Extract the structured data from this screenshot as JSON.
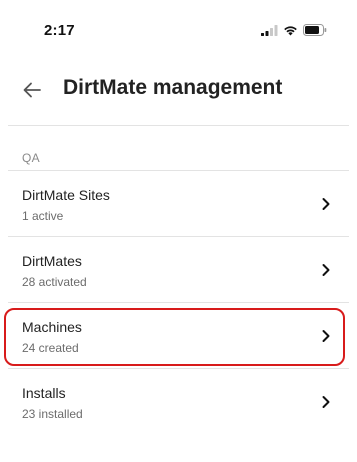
{
  "status_bar": {
    "time": "2:17",
    "icons": [
      "cellular-signal-icon",
      "wifi-icon",
      "battery-icon"
    ]
  },
  "header": {
    "back_icon": "arrow-left-icon",
    "title": "DirtMate management"
  },
  "section": {
    "label": "QA"
  },
  "items": [
    {
      "title": "DirtMate Sites",
      "subtitle": "1 active",
      "icon": "chevron-right-icon"
    },
    {
      "title": "DirtMates",
      "subtitle": "28 activated",
      "icon": "chevron-right-icon"
    },
    {
      "title": "Machines",
      "subtitle": "24 created",
      "icon": "chevron-right-icon",
      "highlighted": true
    },
    {
      "title": "Installs",
      "subtitle": "23 installed",
      "icon": "chevron-right-icon"
    }
  ],
  "colors": {
    "highlight": "#d81b1b",
    "divider": "#e3e3e3",
    "subtitle": "#6c6c6c"
  }
}
